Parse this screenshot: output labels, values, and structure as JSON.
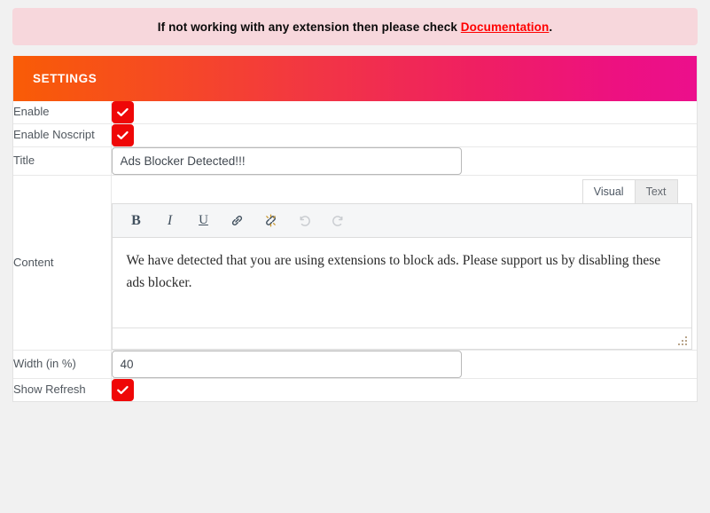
{
  "notice": {
    "text_before": "If not working with any extension then please check ",
    "link_label": "Documentation",
    "text_after": ".",
    "background_color": "#f7d7dc",
    "link_color": "#ff0000"
  },
  "panel": {
    "header_title": "SETTINGS",
    "gradient_start": "#f95c06",
    "gradient_end": "#ec0f8c"
  },
  "rows": {
    "enable": {
      "label": "Enable",
      "checked": true
    },
    "enable_noscript": {
      "label": "Enable Noscript",
      "checked": true
    },
    "title": {
      "label": "Title",
      "value": "Ads Blocker Detected!!!",
      "placeholder": ""
    },
    "content": {
      "label": "Content"
    },
    "width": {
      "label": "Width (in %)",
      "value": "40",
      "placeholder": ""
    },
    "show_refresh": {
      "label": "Show Refresh",
      "checked": true
    }
  },
  "editor": {
    "tabs": [
      {
        "label": "Visual",
        "active": true
      },
      {
        "label": "Text",
        "active": false
      }
    ],
    "toolbar": [
      {
        "name": "bold-icon",
        "glyph": "B",
        "disabled": false
      },
      {
        "name": "italic-icon",
        "glyph": "I",
        "disabled": false
      },
      {
        "name": "underline-icon",
        "glyph": "U",
        "disabled": false
      },
      {
        "name": "link-icon",
        "glyph": "link",
        "disabled": false
      },
      {
        "name": "unlink-icon",
        "glyph": "unlink",
        "disabled": false
      },
      {
        "name": "undo-icon",
        "glyph": "undo",
        "disabled": true
      },
      {
        "name": "redo-icon",
        "glyph": "redo",
        "disabled": true
      }
    ],
    "body_text": "We have detected that you are using extensions to block ads. Please support us by disabling these ads blocker.",
    "resize_grip": "resize-handle-icon"
  },
  "checkbox_color": "#ef0707"
}
